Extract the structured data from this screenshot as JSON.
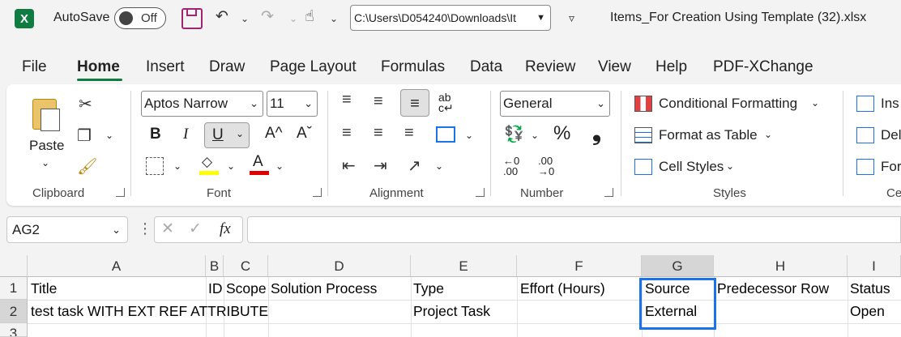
{
  "titlebar": {
    "app_icon": "excel-icon",
    "autosave_label": "AutoSave",
    "autosave_state": "Off",
    "path": "C:\\Users\\D054240\\Downloads\\It",
    "filename": "Items_For Creation Using Template (32).xlsx"
  },
  "menu": [
    "File",
    "Home",
    "Insert",
    "Draw",
    "Page Layout",
    "Formulas",
    "Data",
    "Review",
    "View",
    "Help",
    "PDF-XChange"
  ],
  "menu_active": "Home",
  "ribbon": {
    "clipboard": {
      "paste": "Paste",
      "group": "Clipboard"
    },
    "font": {
      "family": "Aptos Narrow",
      "size": "11",
      "bold": "B",
      "italic": "I",
      "underline": "U",
      "grow": "A^",
      "shrink": "Aˇ",
      "group": "Font"
    },
    "alignment": {
      "group": "Alignment"
    },
    "number": {
      "format": "General",
      "percent": "%",
      "comma": "❟",
      "inc": "←0\n.00",
      "dec": ".00\n→0",
      "group": "Number"
    },
    "styles": {
      "conditional": "Conditional Formatting",
      "table": "Format as Table",
      "cell_styles": "Cell Styles",
      "group": "Styles"
    },
    "cells": {
      "insert": "Ins",
      "delete": "Del",
      "format": "For",
      "group": "Ce"
    }
  },
  "formula_bar": {
    "name_box": "AG2",
    "fx": "fx",
    "formula": ""
  },
  "columns": [
    "A",
    "B",
    "C",
    "D",
    "E",
    "F",
    "G",
    "H",
    "I"
  ],
  "rows": [
    "1",
    "2",
    "3"
  ],
  "cells": {
    "A1": "Title",
    "B1": "ID",
    "C1": "Scope",
    "D1": "Solution Process",
    "E1": "Type",
    "F1": "Effort (Hours)",
    "G1": "Source",
    "H1": "Predecessor Row",
    "I1": "Status",
    "A2": "test task WITH EXT REF ATTRIBUTE",
    "E2": "Project Task",
    "G2": "External",
    "I2": "Open"
  },
  "colors": {
    "accent": "#107c41",
    "selection": "#1a73e8"
  }
}
